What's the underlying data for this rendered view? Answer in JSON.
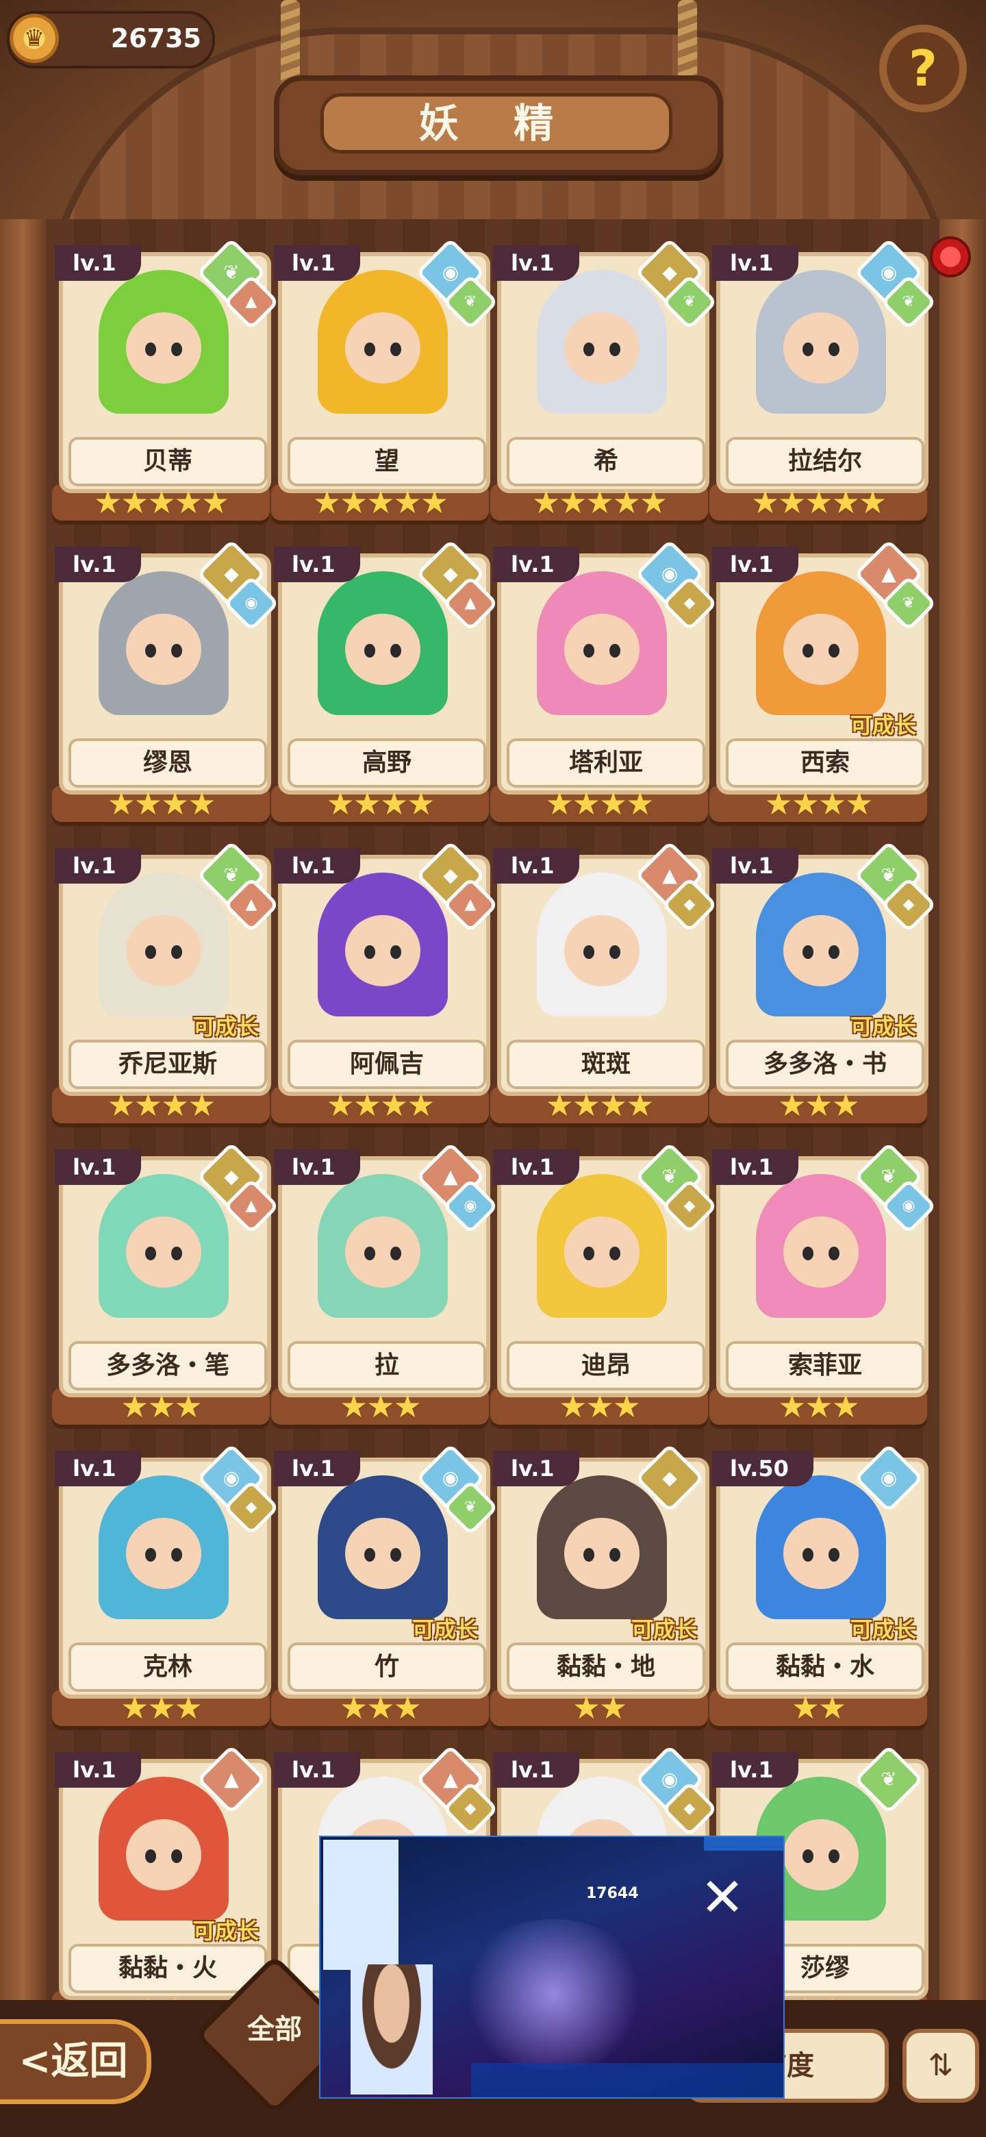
{
  "header": {
    "title": "妖 精",
    "coins": "26735",
    "help_icon": "question-sprout-icon"
  },
  "colors": {
    "grass": "#8fcf6a",
    "water": "#7ac4e6",
    "earth": "#c8a64a",
    "fire": "#d98a6a",
    "level_badge": "#4d2a3a",
    "star": "#ffd64a"
  },
  "cards": [
    {
      "lv": "lv.1",
      "name": "贝蒂",
      "stars": "★★★★★",
      "main": "grass",
      "sub": "fire",
      "growable": "",
      "hair": "#7ccf3c"
    },
    {
      "lv": "lv.1",
      "name": "望",
      "stars": "★★★★★",
      "main": "water",
      "sub": "grass",
      "growable": "",
      "hair": "#f2b629"
    },
    {
      "lv": "lv.1",
      "name": "希",
      "stars": "★★★★★",
      "main": "earth",
      "sub": "grass",
      "growable": "",
      "hair": "#d9dde6"
    },
    {
      "lv": "lv.1",
      "name": "拉结尔",
      "stars": "★★★★★",
      "main": "water",
      "sub": "grass",
      "growable": "",
      "hair": "#b9c2cf"
    },
    {
      "lv": "lv.1",
      "name": "缪恩",
      "stars": "★★★★",
      "main": "earth",
      "sub": "water",
      "growable": "",
      "hair": "#9ea5ad"
    },
    {
      "lv": "lv.1",
      "name": "高野",
      "stars": "★★★★",
      "main": "earth",
      "sub": "fire",
      "growable": "",
      "hair": "#36b86a"
    },
    {
      "lv": "lv.1",
      "name": "塔利亚",
      "stars": "★★★★",
      "main": "water",
      "sub": "earth",
      "growable": "",
      "hair": "#ef8ab8"
    },
    {
      "lv": "lv.1",
      "name": "西索",
      "stars": "★★★★",
      "main": "fire",
      "sub": "grass",
      "growable": "可成长",
      "hair": "#f19a3a"
    },
    {
      "lv": "lv.1",
      "name": "乔尼亚斯",
      "stars": "★★★★",
      "main": "grass",
      "sub": "fire",
      "growable": "可成长",
      "hair": "#e6e2cf"
    },
    {
      "lv": "lv.1",
      "name": "阿佩吉",
      "stars": "★★★★",
      "main": "earth",
      "sub": "fire",
      "growable": "",
      "hair": "#7b47c9"
    },
    {
      "lv": "lv.1",
      "name": "斑斑",
      "stars": "★★★★",
      "main": "fire",
      "sub": "earth",
      "growable": "",
      "hair": "#f0f0f0"
    },
    {
      "lv": "lv.1",
      "name": "多多洛・书",
      "stars": "★★★",
      "main": "grass",
      "sub": "earth",
      "growable": "可成长",
      "hair": "#4a90e0"
    },
    {
      "lv": "lv.1",
      "name": "多多洛・笔",
      "stars": "★★★",
      "main": "earth",
      "sub": "fire",
      "growable": "",
      "hair": "#7fd8b8"
    },
    {
      "lv": "lv.1",
      "name": "拉",
      "stars": "★★★",
      "main": "fire",
      "sub": "water",
      "growable": "",
      "hair": "#84d6b6"
    },
    {
      "lv": "lv.1",
      "name": "迪昂",
      "stars": "★★★",
      "main": "grass",
      "sub": "earth",
      "growable": "",
      "hair": "#f2c63a"
    },
    {
      "lv": "lv.1",
      "name": "索菲亚",
      "stars": "★★★",
      "main": "grass",
      "sub": "water",
      "growable": "",
      "hair": "#f08ab8"
    },
    {
      "lv": "lv.1",
      "name": "克林",
      "stars": "★★★",
      "main": "water",
      "sub": "earth",
      "growable": "",
      "hair": "#4fb6d8"
    },
    {
      "lv": "lv.1",
      "name": "竹",
      "stars": "★★★",
      "main": "water",
      "sub": "grass",
      "growable": "可成长",
      "hair": "#2c4a8a"
    },
    {
      "lv": "lv.1",
      "name": "黏黏・地",
      "stars": "★★",
      "main": "earth",
      "sub": "",
      "growable": "可成长",
      "hair": "#5a4a42"
    },
    {
      "lv": "lv.50",
      "name": "黏黏・水",
      "stars": "★★",
      "main": "water",
      "sub": "",
      "growable": "可成长",
      "hair": "#3c86e0"
    },
    {
      "lv": "lv.1",
      "name": "黏黏・火",
      "stars": "★★",
      "main": "fire",
      "sub": "",
      "growable": "可成长",
      "hair": "#e0563a"
    },
    {
      "lv": "lv.1",
      "name": "",
      "stars": "",
      "main": "fire",
      "sub": "earth",
      "growable": "",
      "hair": "#f0f0f0"
    },
    {
      "lv": "lv.1",
      "name": "",
      "stars": "",
      "main": "water",
      "sub": "earth",
      "growable": "",
      "hair": "#f0f0f0"
    },
    {
      "lv": "lv.1",
      "name": "莎缪",
      "stars": "★★",
      "main": "grass",
      "sub": "",
      "growable": "",
      "hair": "#6cc86a"
    }
  ],
  "bottom": {
    "back": "<返回",
    "all": "全部",
    "sort": "有度",
    "order_icon": "sort-order-icon"
  },
  "overlay": {
    "close_icon": "close-icon",
    "readout": "17644"
  }
}
